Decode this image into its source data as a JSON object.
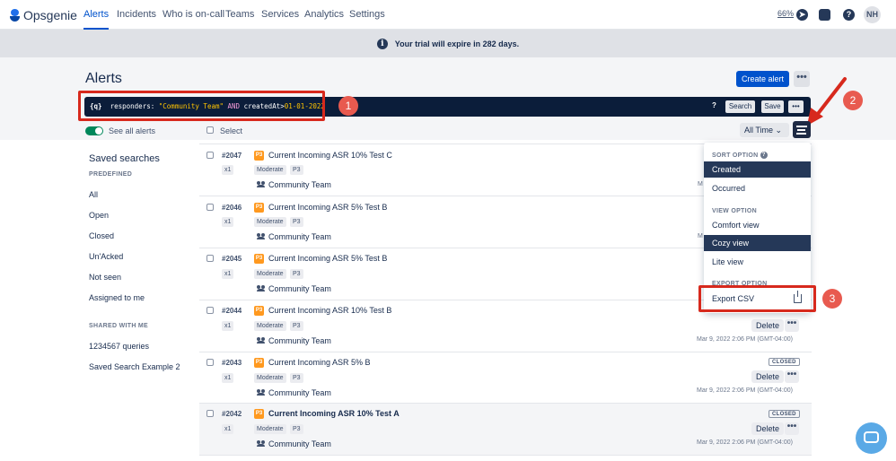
{
  "nav": {
    "logo_text": "Opsgenie",
    "items": [
      "Alerts",
      "Incidents",
      "Who is on-call",
      "Teams",
      "Services",
      "Analytics",
      "Settings"
    ],
    "progress_label": "66%",
    "avatar_initials": "NH",
    "icons": [
      "compass-icon",
      "apps-icon",
      "help-icon"
    ]
  },
  "banner": {
    "text": "Your trial will expire in 282 days."
  },
  "page": {
    "title": "Alerts",
    "create_label": "Create alert",
    "more_label": "•••"
  },
  "query": {
    "prefix": "{q}",
    "field1": "responders:",
    "value1": "\"Community Team\"",
    "op": "AND",
    "field2": "createdAt>",
    "value2": "01-01-2022",
    "help_label": "?",
    "search_label": "Search",
    "save_label": "Save",
    "more_label": "•••"
  },
  "toolbar": {
    "see_all_label": "See all alerts",
    "select_label": "Select",
    "time_label": "All Time ⌄"
  },
  "sidebar": {
    "title": "Saved searches",
    "predefined_header": "PREDEFINED",
    "predefined": [
      "All",
      "Open",
      "Closed",
      "Un'Acked",
      "Not seen",
      "Assigned to me"
    ],
    "shared_header": "SHARED WITH ME",
    "shared": [
      "1234567 queries",
      "Saved Search Example 2"
    ]
  },
  "alerts": [
    {
      "id": "#2047",
      "count": "x1",
      "priority": "P3",
      "title": "Current Incoming ASR 10% Test C",
      "tags": [
        "Moderate",
        "P3"
      ],
      "team": "Community Team",
      "time_partial": "M"
    },
    {
      "id": "#2046",
      "count": "x1",
      "priority": "P3",
      "title": "Current Incoming ASR 5% Test B",
      "tags": [
        "Moderate",
        "P3"
      ],
      "team": "Community Team",
      "time_partial": "M"
    },
    {
      "id": "#2045",
      "count": "x1",
      "priority": "P3",
      "title": "Current Incoming ASR 5% Test B",
      "tags": [
        "Moderate",
        "P3"
      ],
      "team": "Community Team"
    },
    {
      "id": "#2044",
      "count": "x1",
      "priority": "P3",
      "title": "Current Incoming ASR 10% Test B",
      "tags": [
        "Moderate",
        "P3"
      ],
      "team": "Community Team",
      "delete_label": "Delete",
      "time": "Mar 9, 2022 2:06 PM (GMT-04:00)"
    },
    {
      "id": "#2043",
      "count": "x1",
      "priority": "P3",
      "title": "Current Incoming ASR 5% B",
      "tags": [
        "Moderate",
        "P3"
      ],
      "team": "Community Team",
      "status": "CLOSED",
      "delete_label": "Delete",
      "time": "Mar 9, 2022 2:06 PM (GMT-04:00)"
    },
    {
      "id": "#2042",
      "count": "x1",
      "priority": "P3",
      "title": "Current Incoming ASR 10% Test A",
      "tags": [
        "Moderate",
        "P3"
      ],
      "team": "Community Team",
      "status": "CLOSED",
      "delete_label": "Delete",
      "time": "Mar 9, 2022 2:06 PM (GMT-04:00)"
    }
  ],
  "dropdown": {
    "sort_header": "SORT OPTION",
    "sort_help": "?",
    "sort_items": [
      "Created",
      "Occurred"
    ],
    "view_header": "VIEW OPTION",
    "view_items": [
      "Comfort view",
      "Cozy view",
      "Lite view"
    ],
    "export_header": "EXPORT OPTION",
    "export_label": "Export CSV"
  },
  "annotations": {
    "one": "1",
    "two": "2",
    "three": "3"
  },
  "colors": {
    "primary": "#0052cc",
    "query_bar": "#0b1d3a",
    "annotation": "#d7291d",
    "priority_p3": "#ff991f"
  }
}
